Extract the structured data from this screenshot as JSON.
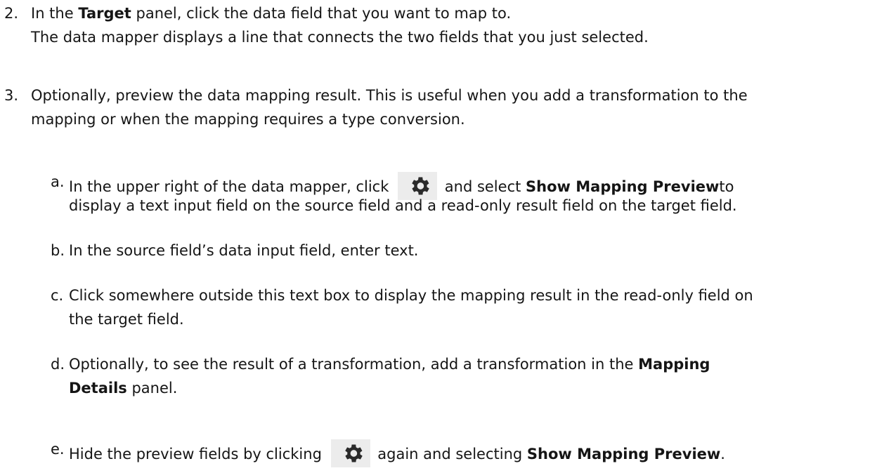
{
  "step2": {
    "number": "2.",
    "line1_pre": "In the",
    "line1_bold": "Target",
    "line1_post": "panel, click the data field that you want to map to.",
    "line2": "The data mapper displays a line that connects the two fields that you just selected."
  },
  "step3": {
    "number": "3.",
    "line1": "Optionally, preview the data mapping result. This is useful when you add a transformation to the",
    "line2": "mapping or when the mapping requires a type conversion."
  },
  "substeps": {
    "a": {
      "marker": "a.",
      "pre": "In the upper right of the data mapper, click",
      "mid": "and select",
      "bold": "Show Mapping Preview",
      "post": "to",
      "line2": "display a text input field on the source field and a read-only result field on the target field."
    },
    "b": {
      "marker": "b.",
      "text": "In the source field’s data input field, enter text."
    },
    "c": {
      "marker": "c.",
      "line1": "Click somewhere outside this text box to display the mapping result in the read-only field on",
      "line2": "the target field."
    },
    "d": {
      "marker": "d.",
      "line1_pre": "Optionally, to see the result of a transformation, add a transformation in the",
      "line1_bold": "Mapping",
      "line2_bold": "Details",
      "line2_post": "panel."
    },
    "e": {
      "marker": "e.",
      "pre": "Hide the preview fields by clicking",
      "mid": "again and selecting",
      "bold": "Show Mapping Preview",
      "post": "."
    }
  },
  "icons": {
    "settings": "gear-icon"
  },
  "colors": {
    "text": "#151515",
    "icon_background": "#ececec",
    "icon_fill": "#2a2a2a"
  }
}
